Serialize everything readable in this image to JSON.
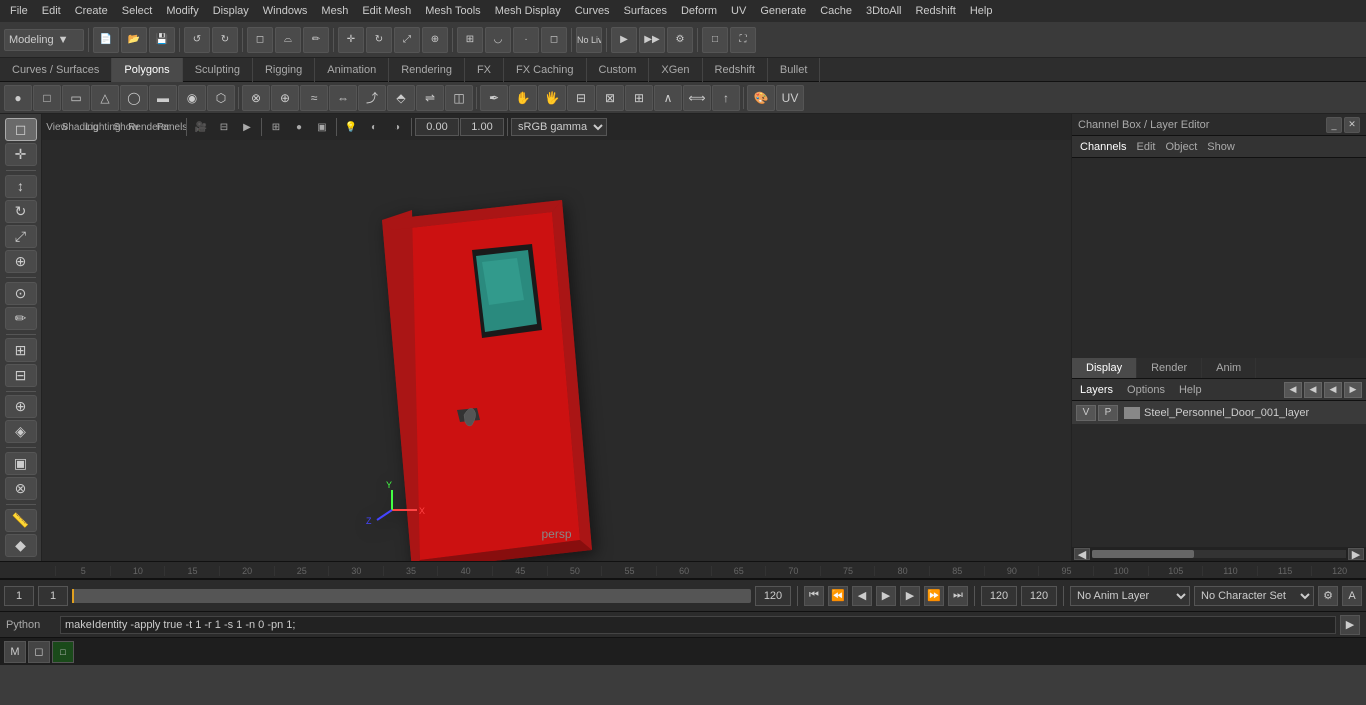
{
  "menubar": {
    "items": [
      "File",
      "Edit",
      "Create",
      "Select",
      "Modify",
      "Display",
      "Windows",
      "Mesh",
      "Edit Mesh",
      "Mesh Tools",
      "Mesh Display",
      "Curves",
      "Surfaces",
      "Deform",
      "UV",
      "Generate",
      "Cache",
      "3DtoAll",
      "Redshift",
      "Help"
    ]
  },
  "toolbar": {
    "mode_dropdown": "Modeling",
    "live_surface": "No Live Surface"
  },
  "tabs": {
    "items": [
      "Curves / Surfaces",
      "Polygons",
      "Sculpting",
      "Rigging",
      "Animation",
      "Rendering",
      "FX",
      "FX Caching",
      "Custom",
      "XGen",
      "Redshift",
      "Bullet"
    ],
    "active": "Polygons"
  },
  "viewport": {
    "label": "persp",
    "gamma": "sRGB gamma",
    "coord_x": "0.00",
    "coord_y": "1.00"
  },
  "rightpanel": {
    "title": "Channel Box / Layer Editor",
    "nav_items": [
      "Channels",
      "Edit",
      "Object",
      "Show"
    ],
    "bottom_tabs": [
      "Display",
      "Render",
      "Anim"
    ],
    "active_bottom_tab": "Display",
    "layers_nav": [
      "Layers",
      "Options",
      "Help"
    ],
    "layer_name": "Steel_Personnel_Door_001_layer",
    "layer_v": "V",
    "layer_p": "P"
  },
  "timeline": {
    "ticks": [
      "5",
      "10",
      "15",
      "20",
      "25",
      "30",
      "35",
      "40",
      "45",
      "50",
      "55",
      "60",
      "65",
      "70",
      "75",
      "80",
      "85",
      "90",
      "95",
      "100",
      "105",
      "110",
      "115",
      "120"
    ]
  },
  "bottombar": {
    "frame_current": "1",
    "frame_start": "1",
    "frame_num": "1",
    "frame_end": "120",
    "playback_end": "120",
    "anim_layer": "No Anim Layer",
    "char_set": "No Character Set"
  },
  "python": {
    "label": "Python",
    "command": "makeIdentity -apply true -t 1 -r 1 -s 1 -n 0 -pn 1;"
  },
  "statusbar": {
    "items": [
      "select1",
      "transform1",
      "frame_icon"
    ]
  },
  "icons": {
    "select": "◻",
    "move": "✛",
    "rotate": "↻",
    "scale": "⤢",
    "universal": "⊕",
    "soft": "⊙",
    "lasso": "⌓",
    "paint": "✏",
    "snap": "⊞",
    "grid": "⊟"
  }
}
